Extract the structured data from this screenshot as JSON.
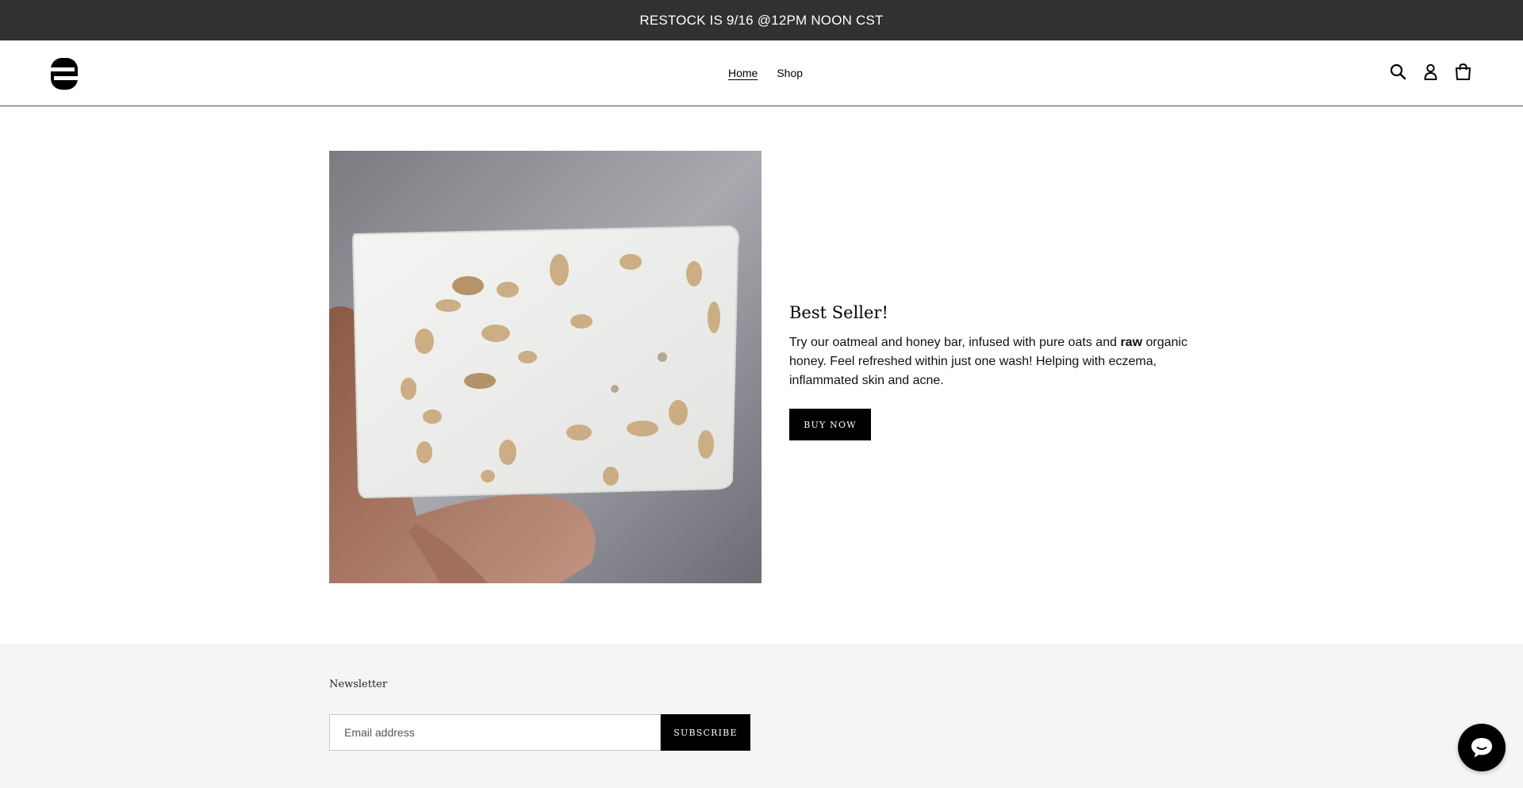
{
  "announcement": {
    "text": "RESTOCK IS 9/16 @12PM NOON CST"
  },
  "header": {
    "logo_icon": "logo-mark-icon",
    "nav": [
      {
        "label": "Home",
        "active": true
      },
      {
        "label": "Shop",
        "active": false
      }
    ],
    "icons": [
      "search-icon",
      "account-icon",
      "cart-icon"
    ]
  },
  "feature": {
    "title": "Best Seller!",
    "body_before": "Try our oatmeal and honey bar, infused with pure oats and ",
    "body_bold": "raw",
    "body_after": " organic honey. Feel refreshed within just one wash! Helping with eczema, inflammated skin and acne.",
    "button_label": "BUY NOW"
  },
  "footer": {
    "newsletter_title": "Newsletter",
    "email_placeholder": "Email address",
    "email_value": "",
    "subscribe_label": "SUBSCRIBE"
  },
  "chat": {
    "icon": "chat-bubble-icon"
  },
  "colors": {
    "announcement_bg": "#313131",
    "button_bg": "#000000",
    "footer_bg": "#f5f5f5"
  }
}
